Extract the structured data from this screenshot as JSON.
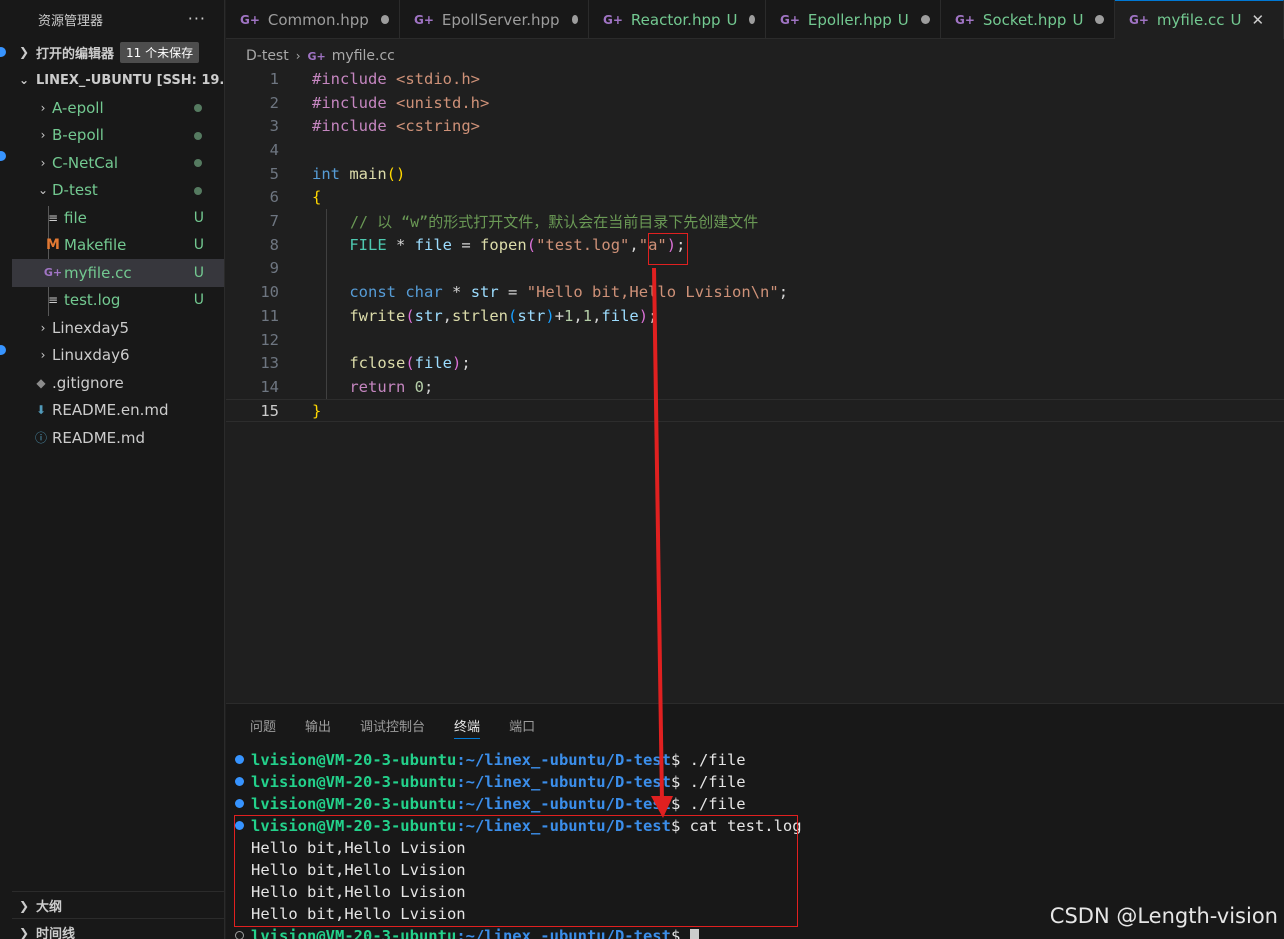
{
  "sidebar": {
    "title": "资源管理器",
    "more": "···",
    "open_editors": "打开的编辑器",
    "unsaved_badge": "11 个未保存",
    "workspace": "LINEX_-UBUNTU [SSH: 19...",
    "tree": [
      {
        "label": "A-epoll",
        "type": "folder"
      },
      {
        "label": "B-epoll",
        "type": "folder"
      },
      {
        "label": "C-NetCal",
        "type": "folder"
      },
      {
        "label": "D-test",
        "type": "folder-open"
      },
      {
        "label": "file",
        "type": "file",
        "status": "U"
      },
      {
        "label": "Makefile",
        "type": "makefile",
        "status": "U"
      },
      {
        "label": "myfile.cc",
        "type": "cpp",
        "status": "U"
      },
      {
        "label": "test.log",
        "type": "file",
        "status": "U"
      },
      {
        "label": "Linexday5",
        "type": "folder"
      },
      {
        "label": "Linuxday6",
        "type": "folder"
      },
      {
        "label": ".gitignore",
        "type": "git"
      },
      {
        "label": "README.en.md",
        "type": "download"
      },
      {
        "label": "README.md",
        "type": "info"
      }
    ],
    "outline": "大纲",
    "timeline": "时间线"
  },
  "tabs": [
    {
      "label": "Common.hpp",
      "status": ""
    },
    {
      "label": "EpollServer.hpp",
      "status": ""
    },
    {
      "label": "Reactor.hpp",
      "status": "U"
    },
    {
      "label": "Epoller.hpp",
      "status": "U"
    },
    {
      "label": "Socket.hpp",
      "status": "U"
    },
    {
      "label": "myfile.cc",
      "status": "U"
    }
  ],
  "breadcrumb": {
    "folder": "D-test",
    "file": "myfile.cc"
  },
  "editor": {
    "line_numbers": [
      "1",
      "2",
      "3",
      "4",
      "5",
      "6",
      "7",
      "8",
      "9",
      "10",
      "11",
      "12",
      "13",
      "14",
      "15"
    ],
    "comment": "// 以 “w”的形式打开文件，默认会在当前目录下先创建文件"
  },
  "panel": {
    "tabs": [
      "问题",
      "输出",
      "调试控制台",
      "终端",
      "端口"
    ],
    "active_tab": "终端",
    "prompt_user": "lvision@VM-20-3-ubuntu",
    "prompt_path": ":~/linex_-ubuntu/D-test",
    "commands": [
      "$ ./file",
      "$ ./file",
      "$ ./file",
      "$ cat test.log"
    ],
    "output": [
      "Hello bit,Hello Lvision",
      "Hello bit,Hello Lvision",
      "Hello bit,Hello Lvision",
      "Hello bit,Hello Lvision"
    ],
    "last_prompt_tail": "$ "
  },
  "watermark": "CSDN @Length-vision",
  "colors": {
    "accent": "#0078d4",
    "annotation_red": "#e02020",
    "untracked_green": "#73c991"
  }
}
